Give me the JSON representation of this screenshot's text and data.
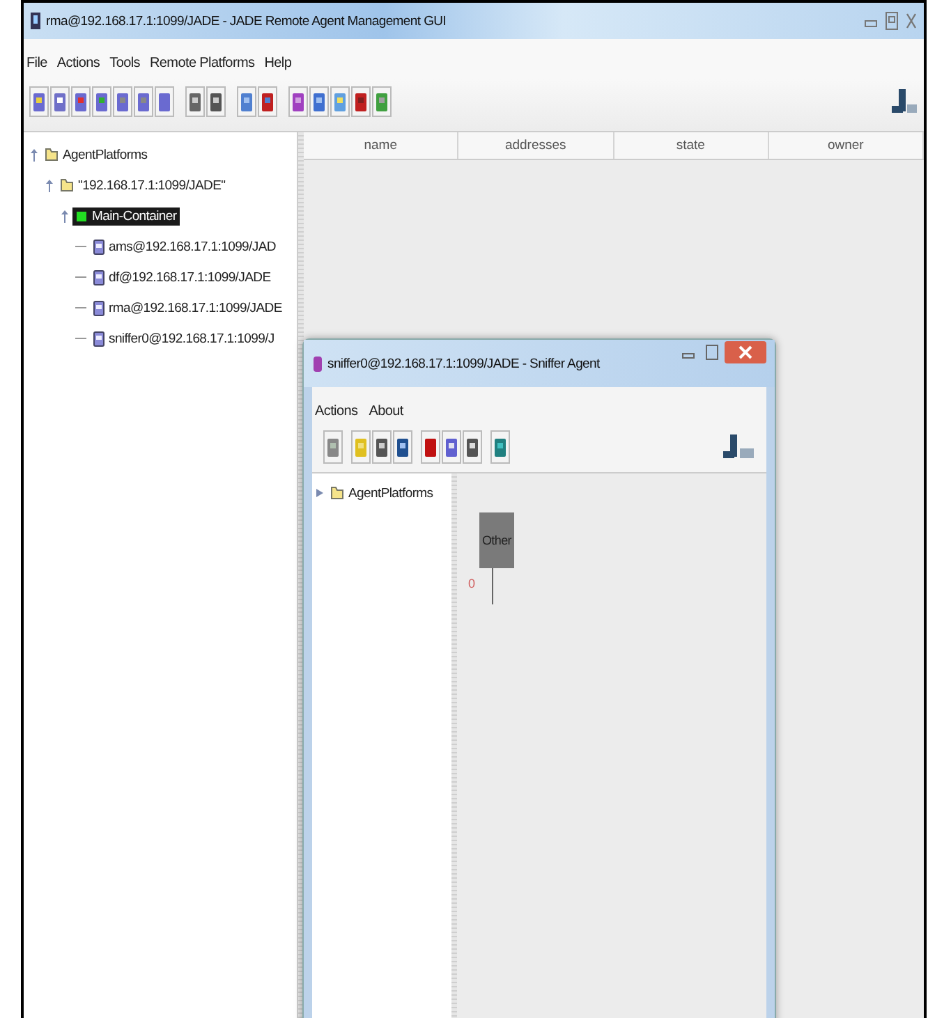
{
  "window": {
    "title": "rma@192.168.17.1:1099/JADE - JADE Remote Agent Management GUI"
  },
  "menu": [
    "File",
    "Actions",
    "Tools",
    "Remote Platforms",
    "Help"
  ],
  "tree": [
    {
      "label": "AgentPlatforms",
      "kind": "folder",
      "expanded": true,
      "selected": false,
      "children": [
        {
          "label": "\"192.168.17.1:1099/JADE\"",
          "kind": "folder",
          "expanded": true,
          "selected": false,
          "children": [
            {
              "label": "Main-Container",
              "kind": "container",
              "expanded": true,
              "selected": true,
              "children": [
                {
                  "label": "ams@192.168.17.1:1099/JAD",
                  "kind": "agent",
                  "selected": false
                },
                {
                  "label": "df@192.168.17.1:1099/JADE",
                  "kind": "agent",
                  "selected": false
                },
                {
                  "label": "rma@192.168.17.1:1099/JADE",
                  "kind": "agent",
                  "selected": false
                },
                {
                  "label": "sniffer0@192.168.17.1:1099/J",
                  "kind": "agent",
                  "selected": false
                }
              ]
            }
          ]
        }
      ]
    }
  ],
  "table": {
    "columns": [
      "name",
      "addresses",
      "state",
      "owner"
    ]
  },
  "sniffer": {
    "title": "sniffer0@192.168.17.1:1099/JADE - Sniffer Agent",
    "menu": [
      "Actions",
      "About"
    ],
    "tree": [
      {
        "label": "AgentPlatforms",
        "kind": "folder",
        "expanded": false,
        "selected": false
      }
    ],
    "agents": [
      {
        "name": "Other",
        "index": "0"
      }
    ]
  }
}
